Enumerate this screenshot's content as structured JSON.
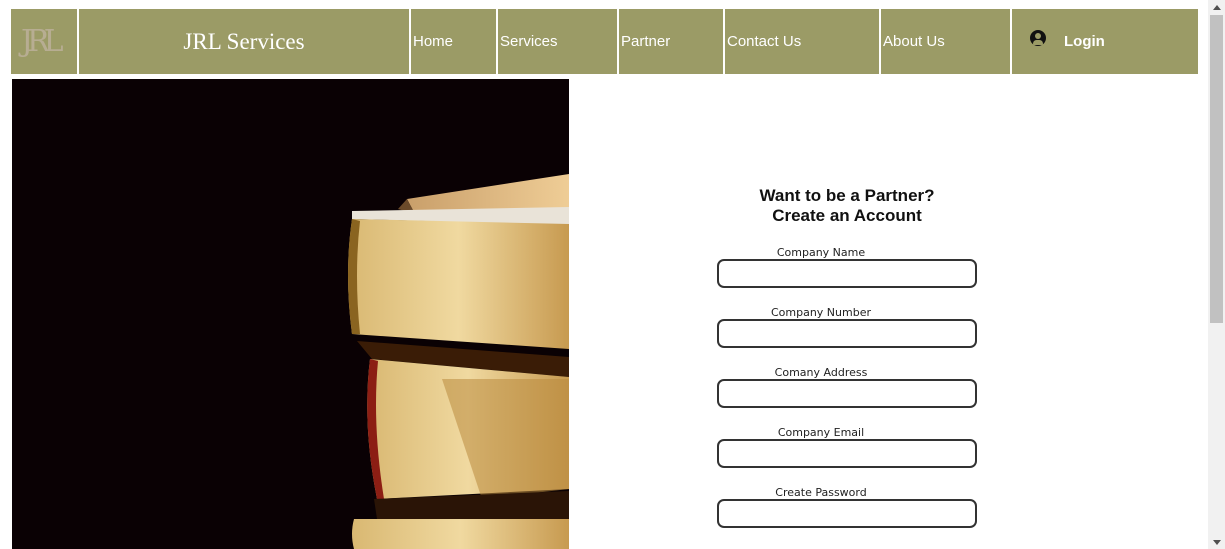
{
  "navbar": {
    "logo_text": "JRL",
    "brand": "JRL Services",
    "links": {
      "home": "Home",
      "services": "Services",
      "partner": "Partner",
      "contact": "Contact Us",
      "about": "About Us"
    },
    "login": "Login"
  },
  "form": {
    "title_line1": "Want to be a Partner?",
    "title_line2": "Create an Account",
    "fields": [
      {
        "label": "Company Name",
        "value": ""
      },
      {
        "label": "Company Number",
        "value": ""
      },
      {
        "label": "Comany Address",
        "value": ""
      },
      {
        "label": "Company Email",
        "value": ""
      },
      {
        "label": "Create Password",
        "value": ""
      }
    ]
  },
  "colors": {
    "nav_bg": "#9b9b66",
    "hero_bg": "#0a0104",
    "page_bg": "#ffffff"
  },
  "icons": {
    "user": "user-circle-icon",
    "scroll_up": "scroll-up-arrow-icon",
    "scroll_down": "scroll-down-arrow-icon"
  }
}
